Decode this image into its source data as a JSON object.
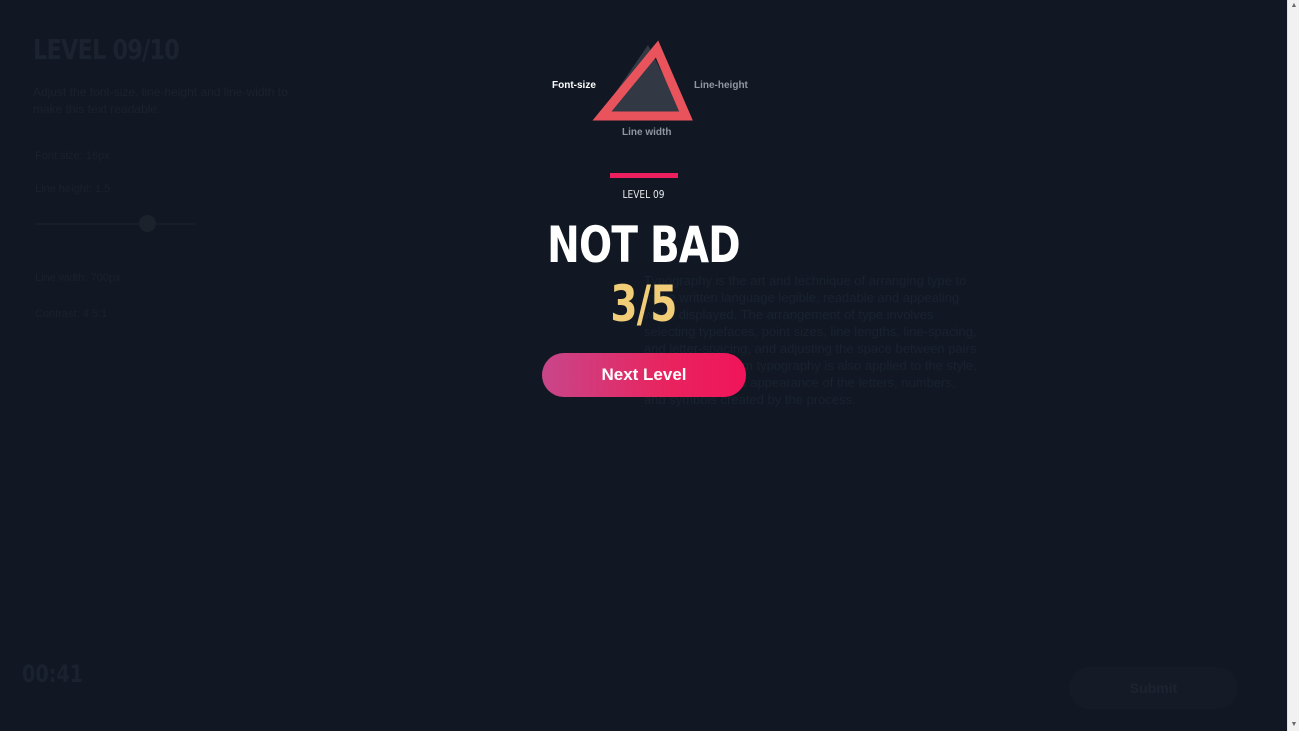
{
  "background": {
    "title": "LEVEL 09/10",
    "description": "Adjust the font-size, line-height and line-width to make this text readable.",
    "fields": [
      "Font size: 16px",
      "Line height: 1.5",
      "Line width: 700px",
      "Contrast: 4.5:1"
    ],
    "paragraph": "Typography is the art and technique of arranging type to make written language legible, readable and appealing when displayed. The arrangement of type involves selecting typefaces, point sizes, line lengths, line-spacing, and letter-spacing, and adjusting the space between pairs of letters. The term typography is also applied to the style, arrangement, and appearance of the letters, numbers, and symbols created by the process.",
    "timer": "00:41",
    "submit_label": "Submit"
  },
  "result": {
    "triangle_labels": {
      "font_size": "Font-size",
      "line_height": "Line-height",
      "line_width": "Line width"
    },
    "level_label": "LEVEL 09",
    "verdict": "NOT BAD",
    "score": "3/5",
    "next_button_label": "Next Level"
  },
  "colors": {
    "background": "#111823",
    "accent": "#ee1f5f",
    "score": "#f1cd78",
    "triangle_active": "#e9545c",
    "triangle_shadow": "#3a3f4a"
  },
  "icons": {
    "triangle": "triangle-score-icon",
    "scroll_up": "scroll-up-arrow-icon",
    "scroll_down": "scroll-down-arrow-icon"
  }
}
